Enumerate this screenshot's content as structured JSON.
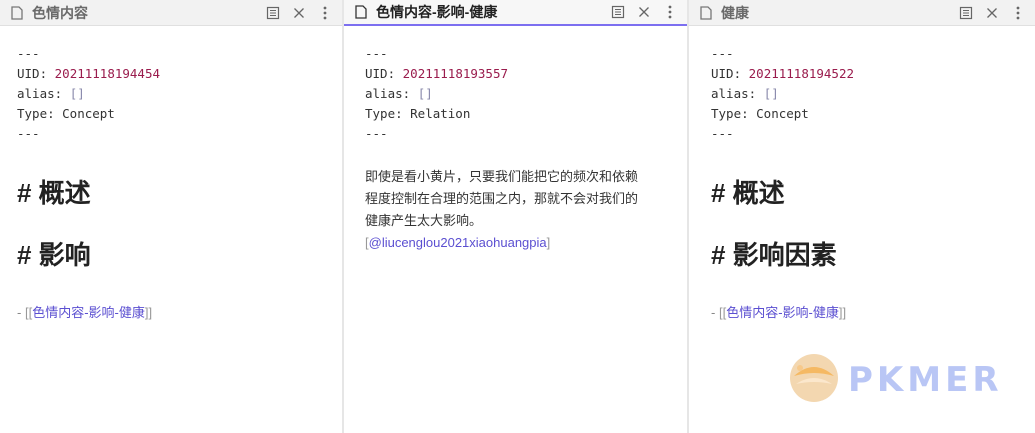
{
  "panes": [
    {
      "tab_title": "色情内容",
      "frontmatter": {
        "dashes": "---",
        "uid_key": "UID: ",
        "uid_value": "20211118194454",
        "alias_key": "alias: ",
        "alias_value": "[]",
        "type_line": "Type: Concept"
      },
      "heading_1": "# 概述",
      "heading_2": "# 影响",
      "link_prefix": "- ",
      "link_open": "[[",
      "link_text": "色情内容-影响-健康",
      "link_close": "]]"
    },
    {
      "tab_title": "色情内容-影响-健康",
      "frontmatter": {
        "dashes": "---",
        "uid_key": "UID: ",
        "uid_value": "20211118193557",
        "alias_key": "alias: ",
        "alias_value": "[]",
        "type_line": "Type: Relation"
      },
      "paragraph": "即使是看小黄片，只要我们能把它的频次和依赖程度控制在合理的范围之内，那就不会对我们的健康产生太大影响。",
      "cite_open": "[",
      "cite_text": "@liucenglou2021xiaohuangpia",
      "cite_close": "]"
    },
    {
      "tab_title": "健康",
      "frontmatter": {
        "dashes": "---",
        "uid_key": "UID: ",
        "uid_value": "20211118194522",
        "alias_key": "alias: ",
        "alias_value": "[]",
        "type_line": "Type: Concept"
      },
      "heading_1": "# 概述",
      "heading_2": "# 影响因素",
      "link_prefix": "- ",
      "link_open": "[[",
      "link_text": "色情内容-影响-健康",
      "link_close": "]]"
    }
  ],
  "icons": {
    "tab": "document-icon",
    "reading_view": "reading-view-icon",
    "close": "close-icon",
    "more": "more-options-icon"
  },
  "watermark": {
    "text": "PKMER"
  },
  "colors": {
    "accent": "#7c6ff0",
    "link": "#5b4fd1",
    "uid_number": "#9a1c4d",
    "watermark": "#b9c6f5"
  }
}
